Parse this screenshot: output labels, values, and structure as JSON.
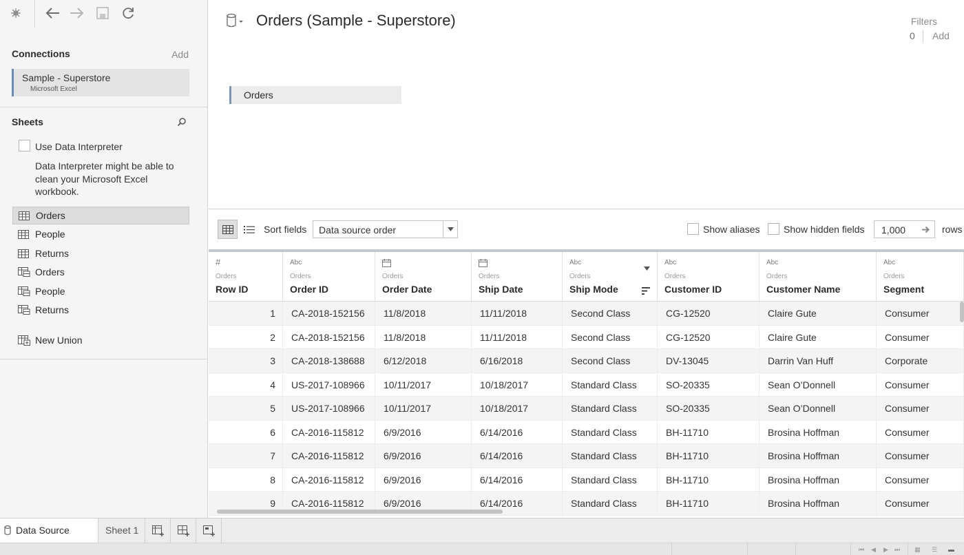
{
  "toolbar": {
    "icons": [
      "tableau-logo-icon",
      "back-arrow-icon",
      "forward-arrow-icon",
      "save-icon",
      "refresh-icon"
    ]
  },
  "connections": {
    "title": "Connections",
    "add_label": "Add",
    "items": [
      {
        "name": "Sample - Superstore",
        "type": "Microsoft Excel"
      }
    ]
  },
  "sheets": {
    "title": "Sheets",
    "search_icon": "search-icon",
    "data_interpreter": {
      "label": "Use Data Interpreter",
      "checked": false,
      "description": "Data Interpreter might be able to clean your Microsoft Excel workbook."
    },
    "items": [
      {
        "label": "Orders",
        "icon": "sheet-table-icon",
        "selected": true
      },
      {
        "label": "People",
        "icon": "sheet-table-icon",
        "selected": false
      },
      {
        "label": "Returns",
        "icon": "sheet-table-icon",
        "selected": false
      },
      {
        "label": "Orders",
        "icon": "named-range-icon",
        "selected": false
      },
      {
        "label": "People",
        "icon": "named-range-icon",
        "selected": false
      },
      {
        "label": "Returns",
        "icon": "named-range-icon",
        "selected": false
      },
      {
        "label": "New Union",
        "icon": "union-icon",
        "selected": false
      }
    ]
  },
  "canvas": {
    "title": "Orders (Sample - Superstore)",
    "table_pill": "Orders",
    "filters": {
      "label": "Filters",
      "count": "0",
      "add_label": "Add"
    }
  },
  "grid_toolbar": {
    "sort_label": "Sort fields",
    "sort_value": "Data source order",
    "show_aliases": "Show aliases",
    "show_hidden": "Show hidden fields",
    "rows_value": "1,000",
    "rows_label": "rows"
  },
  "grid": {
    "columns": [
      {
        "type": "#",
        "table": "Orders",
        "name": "Row ID"
      },
      {
        "type": "Abc",
        "table": "Orders",
        "name": "Order ID"
      },
      {
        "type": "calendar",
        "table": "Orders",
        "name": "Order Date"
      },
      {
        "type": "calendar",
        "table": "Orders",
        "name": "Ship Date"
      },
      {
        "type": "Abc",
        "table": "Orders",
        "name": "Ship Mode"
      },
      {
        "type": "Abc",
        "table": "Orders",
        "name": "Customer ID"
      },
      {
        "type": "Abc",
        "table": "Orders",
        "name": "Customer Name"
      },
      {
        "type": "Abc",
        "table": "Orders",
        "name": "Segment"
      }
    ],
    "rows": [
      [
        "1",
        "CA-2018-152156",
        "11/8/2018",
        "11/11/2018",
        "Second Class",
        "CG-12520",
        "Claire Gute",
        "Consumer"
      ],
      [
        "2",
        "CA-2018-152156",
        "11/8/2018",
        "11/11/2018",
        "Second Class",
        "CG-12520",
        "Claire Gute",
        "Consumer"
      ],
      [
        "3",
        "CA-2018-138688",
        "6/12/2018",
        "6/16/2018",
        "Second Class",
        "DV-13045",
        "Darrin Van Huff",
        "Corporate"
      ],
      [
        "4",
        "US-2017-108966",
        "10/11/2017",
        "10/18/2017",
        "Standard Class",
        "SO-20335",
        "Sean O’Donnell",
        "Consumer"
      ],
      [
        "5",
        "US-2017-108966",
        "10/11/2017",
        "10/18/2017",
        "Standard Class",
        "SO-20335",
        "Sean O’Donnell",
        "Consumer"
      ],
      [
        "6",
        "CA-2016-115812",
        "6/9/2016",
        "6/14/2016",
        "Standard Class",
        "BH-11710",
        "Brosina Hoffman",
        "Consumer"
      ],
      [
        "7",
        "CA-2016-115812",
        "6/9/2016",
        "6/14/2016",
        "Standard Class",
        "BH-11710",
        "Brosina Hoffman",
        "Consumer"
      ],
      [
        "8",
        "CA-2016-115812",
        "6/9/2016",
        "6/14/2016",
        "Standard Class",
        "BH-11710",
        "Brosina Hoffman",
        "Consumer"
      ],
      [
        "9",
        "CA-2016-115812",
        "6/9/2016",
        "6/14/2016",
        "Standard Class",
        "BH-11710",
        "Brosina Hoffman",
        "Consumer"
      ]
    ]
  },
  "tabs": {
    "data_source": "Data Source",
    "sheet1": "Sheet 1",
    "buttons": [
      "new-worksheet-icon",
      "new-dashboard-icon",
      "new-story-icon"
    ]
  },
  "status": {
    "nav_icons": [
      "first-page-icon",
      "prev-page-icon",
      "next-page-icon",
      "last-page-icon"
    ],
    "view_icons": [
      "grid-view-icon",
      "list-view-icon",
      "filmstrip-view-icon"
    ]
  },
  "colors": {
    "accent_connection": "#6b8db5",
    "selected_bg": "#dcdcdc",
    "grid_header_border": "#c2c9d1"
  }
}
